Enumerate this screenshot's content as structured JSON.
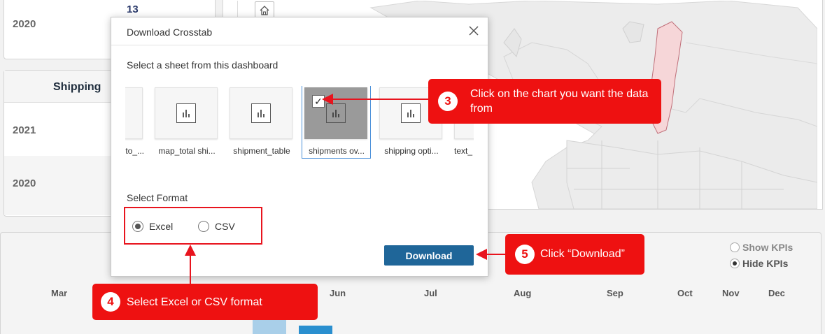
{
  "background": {
    "card1": {
      "value": "13",
      "year": "2020"
    },
    "card2": {
      "header": "Shipping",
      "years": [
        "2021",
        "2020"
      ]
    },
    "months": [
      "Mar",
      "Jun",
      "Jul",
      "Aug",
      "Sep",
      "Oct",
      "Nov",
      "Dec"
    ],
    "kpi_toggle": {
      "show": "Show KPIs",
      "hide": "Hide KPIs",
      "selected": "hide"
    }
  },
  "dialog": {
    "title": "Download Crosstab",
    "sheet_prompt": "Select a sheet from this dashboard",
    "sheets": [
      {
        "label": "to_...",
        "selected": false
      },
      {
        "label": "map_total shi...",
        "selected": false
      },
      {
        "label": "shipment_table",
        "selected": false
      },
      {
        "label": "shipments ov...",
        "selected": true
      },
      {
        "label": "shipping opti...",
        "selected": false
      },
      {
        "label": "text_",
        "selected": false
      }
    ],
    "format_prompt": "Select Format",
    "formats": [
      {
        "label": "Excel",
        "selected": true
      },
      {
        "label": "CSV",
        "selected": false
      }
    ],
    "download_label": "Download"
  },
  "annotations": {
    "step3": {
      "number": "3",
      "text": "Click on the chart you want the data from"
    },
    "step4": {
      "number": "4",
      "text": "Select Excel or CSV format"
    },
    "step5": {
      "number": "5",
      "text": "Click “Download”"
    }
  },
  "colors": {
    "accent": "#1f6699",
    "annotation": "#ee1111",
    "selection": "#4a90d9"
  }
}
